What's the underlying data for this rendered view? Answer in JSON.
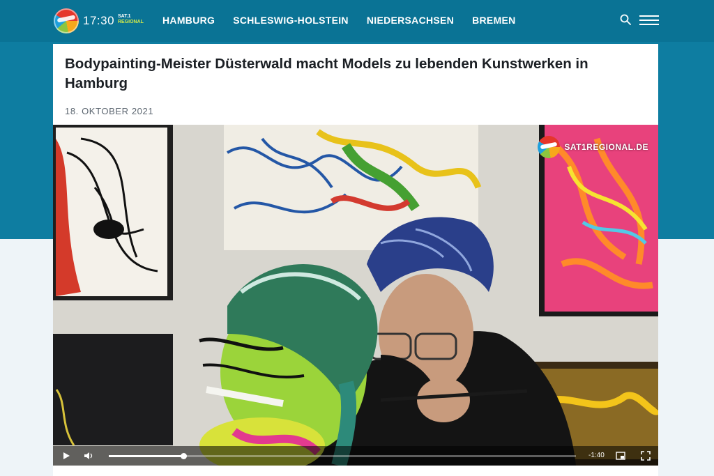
{
  "header": {
    "logo_time": "17:30",
    "logo_sat": "SAT.1",
    "logo_regional": "REGIONAL",
    "nav": [
      "HAMBURG",
      "SCHLESWIG-HOLSTEIN",
      "NIEDERSACHSEN",
      "BREMEN"
    ],
    "search_icon": "search-icon",
    "menu_icon": "hamburger-menu-icon"
  },
  "article": {
    "headline": "Bodypainting-Meister Düsterwald macht Models zu lebenden Kunstwerken in Hamburg",
    "date": "18. OKTOBER 2021"
  },
  "video": {
    "watermark": "SAT1REGIONAL.DE",
    "time_remaining": "-1:40",
    "progress_fraction": 0.16,
    "controls": [
      "play-icon",
      "volume-icon",
      "picture-in-picture-icon",
      "fullscreen-icon"
    ]
  },
  "colors": {
    "header_bg": "#0a7395",
    "band_bg": "#0e7da1",
    "page_bg": "#eef4f8"
  }
}
